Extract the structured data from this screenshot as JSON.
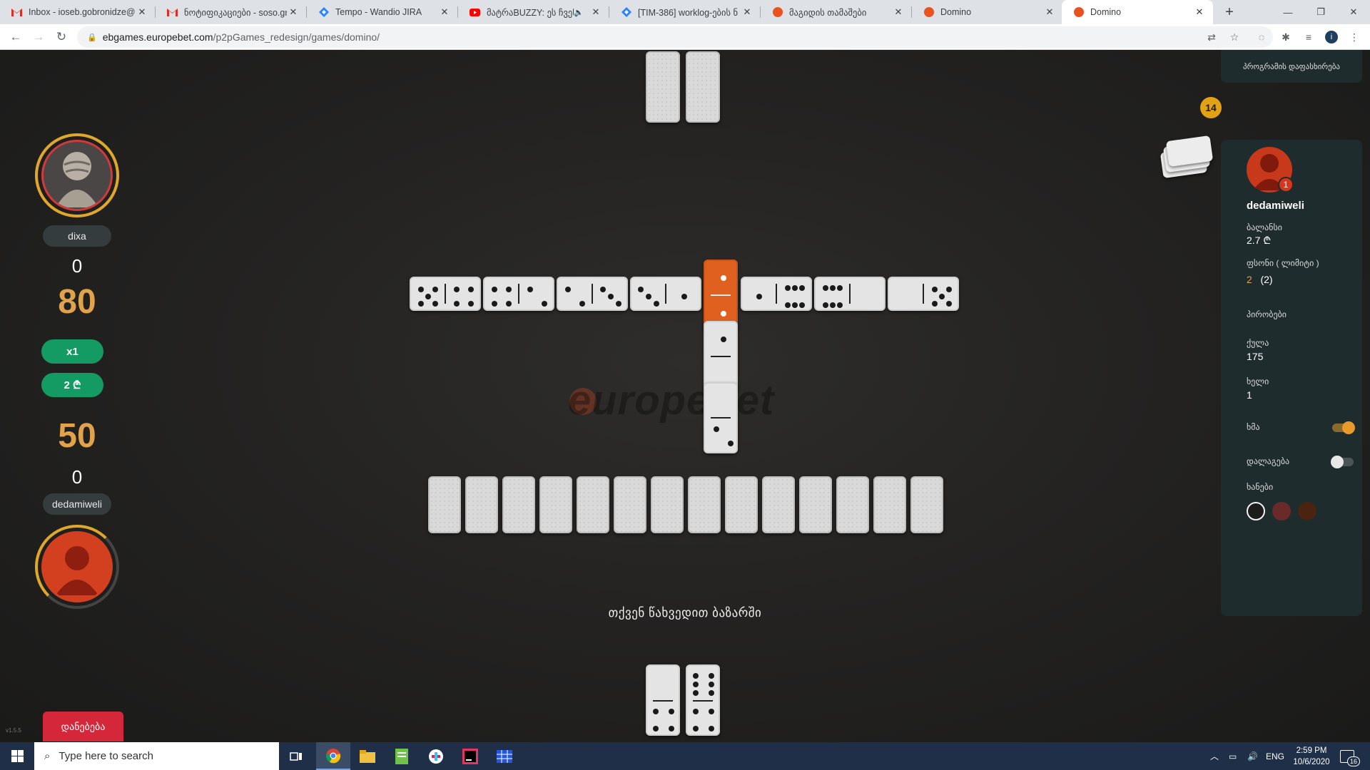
{
  "browser": {
    "tabs": [
      {
        "title": "Inbox - ioseb.gobronidze@",
        "icon": "gmail-icon",
        "color": "#d93025"
      },
      {
        "title": "ნოტიფიკაციები - soso.gr",
        "icon": "gmail-icon",
        "color": "#d93025"
      },
      {
        "title": "Tempo - Wandio JIRA",
        "icon": "jira-icon",
        "color": "#2684ff"
      },
      {
        "title": "მატრაBUZZY: ეს ჩვენ",
        "icon": "youtube-icon",
        "color": "#ff0000"
      },
      {
        "title": "[TIM-386] worklog-ების ნ",
        "icon": "jira-icon",
        "color": "#2684ff"
      },
      {
        "title": "მაგიდის თამაშები",
        "icon": "europebet-icon",
        "color": "#e8531f"
      },
      {
        "title": "Domino",
        "icon": "europebet-icon",
        "color": "#e8531f"
      },
      {
        "title": "Domino",
        "icon": "europebet-icon",
        "color": "#e8531f"
      }
    ],
    "url_host": "ebgames.europebet.com",
    "url_path": "/p2pGames_redesign/games/domino/"
  },
  "game": {
    "watermark": "europebet",
    "opponent": {
      "name": "dixa",
      "points": "0",
      "score": "80"
    },
    "multiplier": "x1",
    "stake": "2 ₾",
    "player": {
      "name": "dedamiweli",
      "points": "0",
      "score": "50"
    },
    "leave_label": "დანებება",
    "version": "v1.5.5",
    "boneyard_count": "14",
    "bazaar_message": "თქვენ წახვედით ბაზარში"
  },
  "side_panel": {
    "rules_label": "პროგრამის დაფასხირება",
    "username": "dedamiweli",
    "rank": "1",
    "balance_label": "ბალანსი",
    "balance_value": "2.7 ₾",
    "bonus_label": "ფსონი ( ლიმიტი )",
    "bonus_value": "2",
    "bonus_limit": "(2)",
    "conditions_label": "პირობები",
    "points_label": "ქულა",
    "points_value": "175",
    "hand_label": "ხელი",
    "hand_value": "1",
    "sound_label": "ხმა",
    "sound_on": true,
    "marker_label": "დალაგება",
    "marker_on": false,
    "colors_label": "ხანები",
    "colors": [
      "#1c1c1c",
      "#6b2a2a",
      "#4a2411"
    ]
  },
  "taskbar": {
    "search_placeholder": "Type here to search",
    "lang": "ENG",
    "time": "2:59 PM",
    "date": "10/6/2020",
    "notifications": "16"
  }
}
